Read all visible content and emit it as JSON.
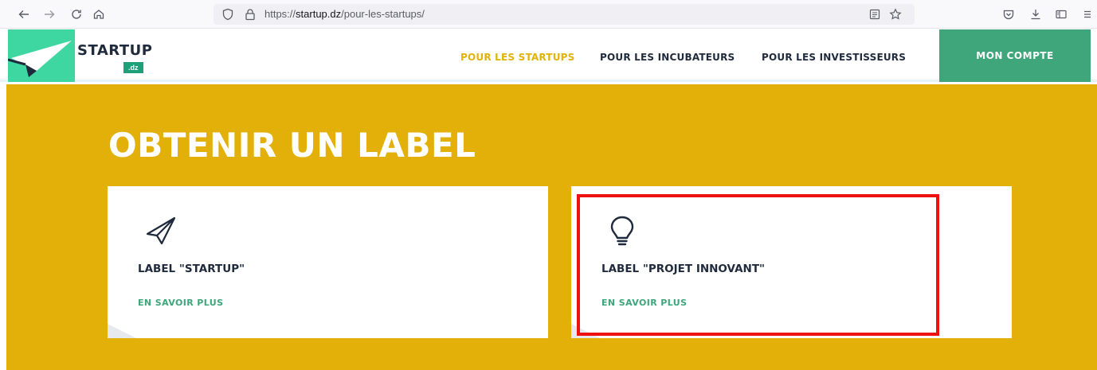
{
  "browser": {
    "url_prefix": "https://",
    "url_domain": "startup.dz",
    "url_path": "/pour-les-startups/",
    "icons": [
      "back-arrow-icon",
      "forward-arrow-icon",
      "reload-icon",
      "home-icon",
      "shield-icon",
      "lock-icon",
      "reader-view-icon",
      "star-icon",
      "pocket-icon",
      "download-icon",
      "sidebar-icon",
      "menu-icon"
    ]
  },
  "header": {
    "logo_text": "STARTUP",
    "logo_suffix": ".dz",
    "nav": [
      {
        "label": "POUR LES STARTUPS",
        "active": true
      },
      {
        "label": "POUR LES INCUBATEURS",
        "active": false
      },
      {
        "label": "POUR LES INVESTISSEURS",
        "active": false
      }
    ],
    "account_label": "MON COMPTE"
  },
  "hero": {
    "title": "OBTENIR UN LABEL",
    "cards": [
      {
        "title": "LABEL \"STARTUP\"",
        "link": "EN SAVOIR PLUS",
        "icon": "paper-plane-icon"
      },
      {
        "title": "LABEL \"PROJET INNOVANT\"",
        "link": "EN SAVOIR PLUS",
        "icon": "lightbulb-icon"
      }
    ]
  },
  "colors": {
    "hero_bg": "#e2b009",
    "brand_green": "#3ea67a",
    "logo_mint": "#3ed6a1",
    "active_nav": "#e2b20a",
    "dark_text": "#1f2a3c",
    "highlight": "#ee1111"
  }
}
